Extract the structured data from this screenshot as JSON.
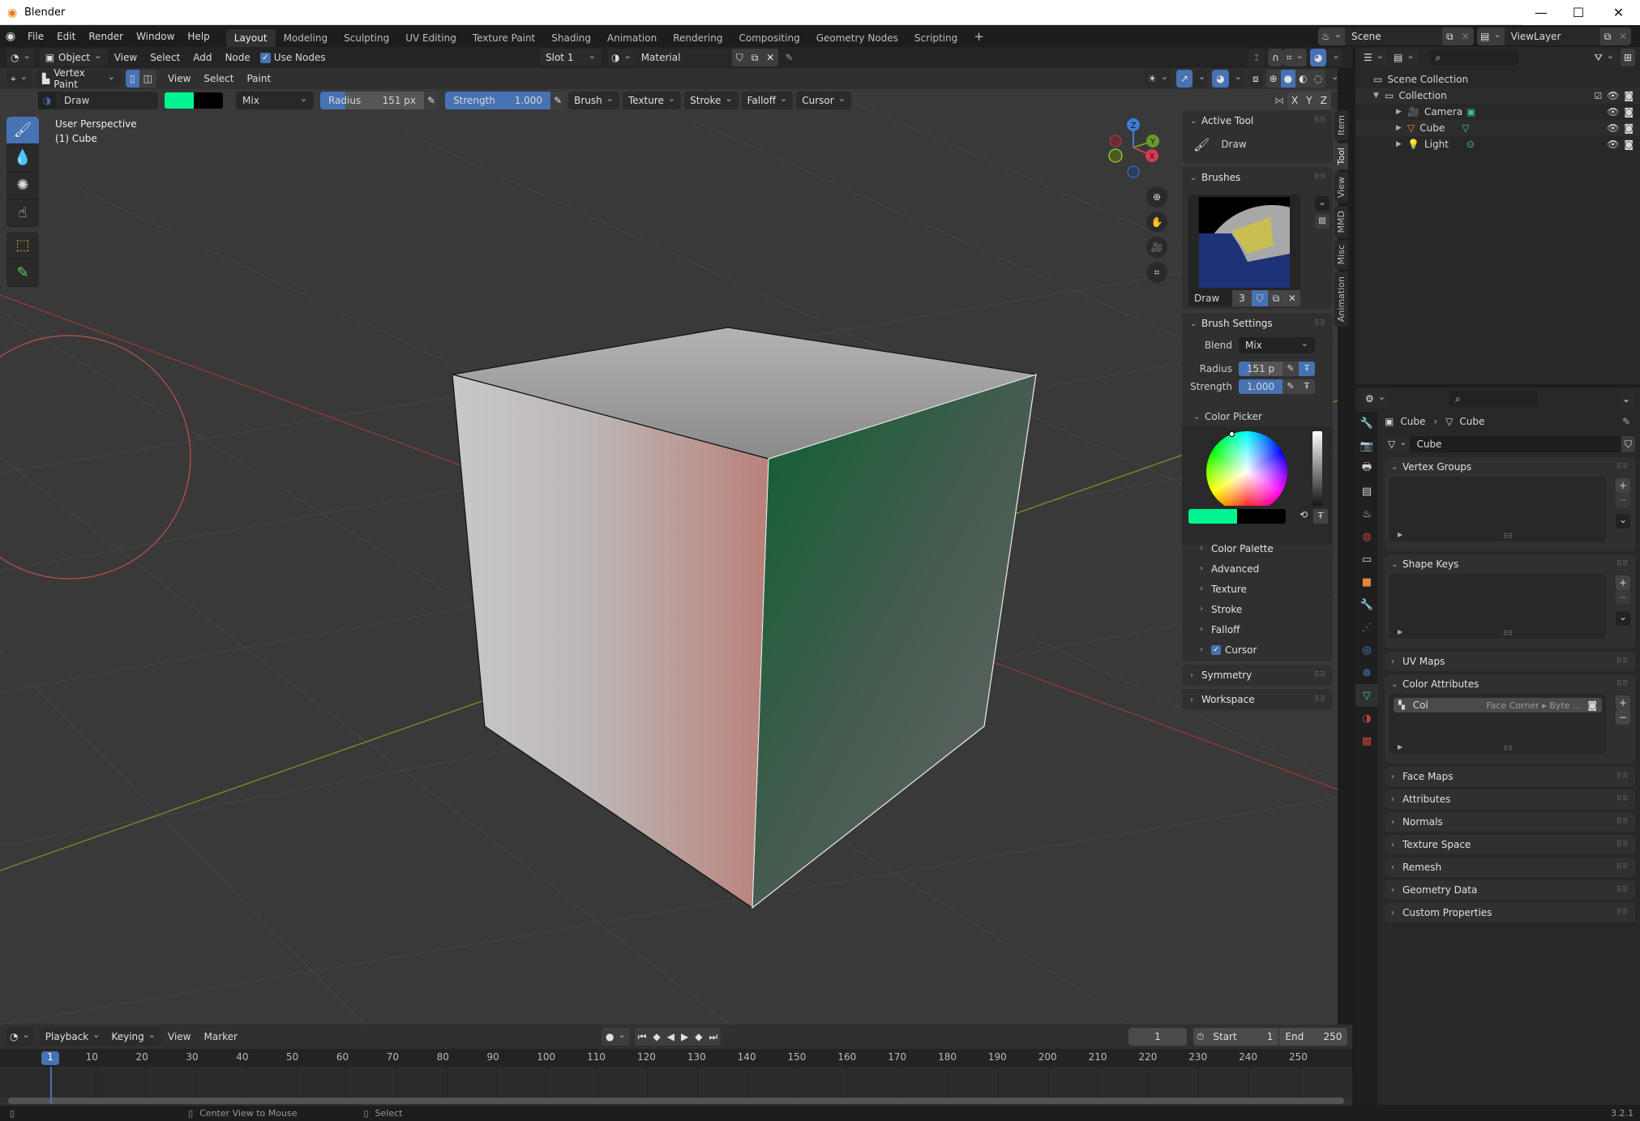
{
  "window": {
    "title": "Blender",
    "controls": [
      "minimize",
      "maximize",
      "close"
    ]
  },
  "menu": {
    "items": [
      "File",
      "Edit",
      "Render",
      "Window",
      "Help"
    ]
  },
  "workspaces": {
    "tabs": [
      "Layout",
      "Modeling",
      "Sculpting",
      "UV Editing",
      "Texture Paint",
      "Shading",
      "Animation",
      "Rendering",
      "Compositing",
      "Geometry Nodes",
      "Scripting"
    ],
    "active": "Layout",
    "add_label": "+"
  },
  "scene": {
    "label": "Scene",
    "view_layer": "ViewLayer"
  },
  "shader_header": {
    "editor_mode": "Object",
    "menus": [
      "View",
      "Select",
      "Add",
      "Node"
    ],
    "use_nodes_label": "Use Nodes",
    "use_nodes_checked": true,
    "slot": "Slot 1",
    "material": "Material"
  },
  "viewport_header": {
    "mode": "Vertex Paint",
    "menus": [
      "View",
      "Select",
      "Paint"
    ]
  },
  "tool_settings": {
    "brush_name": "Draw",
    "primary_color": "#00f58f",
    "secondary_color": "#000000",
    "blend": "Mix",
    "radius_label": "Radius",
    "radius_value": "151 px",
    "strength_label": "Strength",
    "strength_value": "1.000",
    "popovers": [
      "Brush",
      "Texture",
      "Stroke",
      "Falloff",
      "Cursor"
    ],
    "axes": [
      "X",
      "Y",
      "Z"
    ]
  },
  "viewport": {
    "perspective": "User Perspective",
    "object": "(1) Cube",
    "gizmo_axes": [
      "Z",
      "Y",
      "X"
    ]
  },
  "npanel": {
    "tabs": [
      "Item",
      "Tool",
      "View",
      "MMD",
      "Misc",
      "Animation"
    ],
    "active_tab": "Tool",
    "active_tool": {
      "title": "Active Tool",
      "tool": "Draw"
    },
    "brushes": {
      "title": "Brushes",
      "name": "Draw",
      "users": "3"
    },
    "brush_settings": {
      "title": "Brush Settings",
      "blend_label": "Blend",
      "blend": "Mix",
      "radius_label": "Radius",
      "radius": "151 p",
      "strength_label": "Strength",
      "strength": "1.000"
    },
    "color_picker": {
      "title": "Color Picker"
    },
    "subpanels": [
      "Color Palette",
      "Advanced",
      "Texture",
      "Stroke",
      "Falloff"
    ],
    "cursor": {
      "label": "Cursor",
      "checked": true
    },
    "symmetry": "Symmetry",
    "workspace": "Workspace"
  },
  "outliner": {
    "root": "Scene Collection",
    "collection": "Collection",
    "items": [
      {
        "name": "Camera",
        "type": "camera"
      },
      {
        "name": "Cube",
        "type": "mesh"
      },
      {
        "name": "Light",
        "type": "light"
      }
    ]
  },
  "properties": {
    "breadcrumb": [
      "Cube",
      "Cube"
    ],
    "mesh_name": "Cube",
    "sections": {
      "vertex_groups": "Vertex Groups",
      "shape_keys": "Shape Keys",
      "uv_maps": "UV Maps",
      "color_attributes": "Color Attributes",
      "collapsed": [
        "Face Maps",
        "Attributes",
        "Normals",
        "Texture Space",
        "Remesh",
        "Geometry Data",
        "Custom Properties"
      ]
    },
    "color_attribute": {
      "name": "Col",
      "domain": "Face Corner ▸ Byte ..."
    }
  },
  "timeline": {
    "menus": [
      "Playback",
      "Keying",
      "View",
      "Marker"
    ],
    "current_frame": "1",
    "start_label": "Start",
    "start": "1",
    "end_label": "End",
    "end": "250",
    "ticks": [
      "1",
      "10",
      "20",
      "30",
      "40",
      "50",
      "60",
      "70",
      "80",
      "90",
      "100",
      "110",
      "120",
      "130",
      "140",
      "150",
      "160",
      "170",
      "180",
      "190",
      "200",
      "210",
      "220",
      "230",
      "240",
      "250"
    ]
  },
  "statusbar": {
    "hints": [
      "Center View to Mouse",
      "Select"
    ],
    "version": "3.2.1"
  }
}
